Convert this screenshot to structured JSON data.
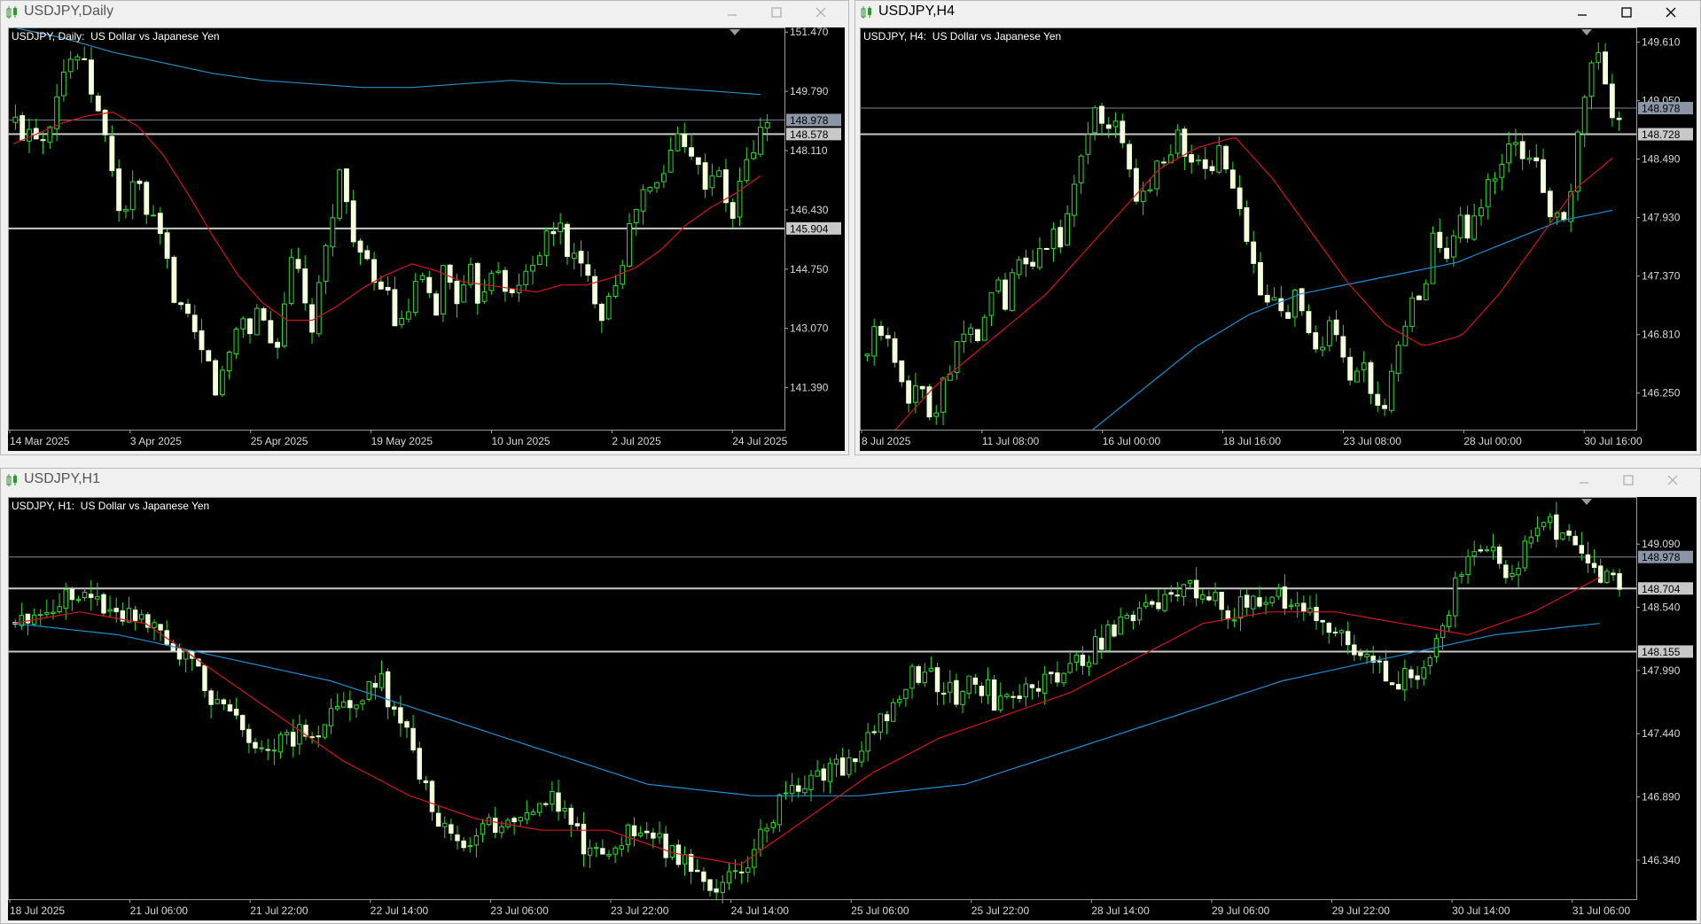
{
  "windows": [
    {
      "id": "daily",
      "title": "USDJPY,Daily",
      "chart_label": "USDJPY, Daily:  US Dollar vs Japanese Yen",
      "active": false,
      "price_ticks": [
        "151.470",
        "149.790",
        "148.110",
        "146.430",
        "144.750",
        "143.070",
        "141.390"
      ],
      "price_tick_values": [
        151.47,
        149.79,
        148.11,
        146.43,
        144.75,
        143.07,
        141.39
      ],
      "time_ticks": [
        "14 Mar 2025",
        "3 Apr 2025",
        "25 Apr 2025",
        "19 May 2025",
        "10 Jun 2025",
        "2 Jul 2025",
        "24 Jul 2025"
      ],
      "price_tags": [
        {
          "label": "148.978",
          "value": 148.978,
          "style": "current"
        },
        {
          "label": "148.578",
          "value": 148.578,
          "style": "level"
        },
        {
          "label": "145.904",
          "value": 145.904,
          "style": "level"
        }
      ],
      "hlines": [
        148.978,
        148.578,
        145.904
      ],
      "ma_colors": {
        "fast": "#d01818",
        "slow": "#2a8fbd"
      }
    },
    {
      "id": "h4",
      "title": "USDJPY,H4",
      "chart_label": "USDJPY, H4:  US Dollar vs Japanese Yen",
      "active": true,
      "price_ticks": [
        "149.610",
        "149.050",
        "148.490",
        "147.930",
        "147.370",
        "146.810",
        "146.250"
      ],
      "price_tick_values": [
        149.61,
        149.05,
        148.49,
        147.93,
        147.37,
        146.81,
        146.25
      ],
      "time_ticks": [
        "8 Jul 2025",
        "11 Jul 08:00",
        "16 Jul 00:00",
        "18 Jul 16:00",
        "23 Jul 08:00",
        "28 Jul 00:00",
        "30 Jul 16:00"
      ],
      "price_tags": [
        {
          "label": "148.978",
          "value": 148.978,
          "style": "current"
        },
        {
          "label": "148.728",
          "value": 148.728,
          "style": "level"
        }
      ],
      "hlines": [
        148.978,
        148.728
      ],
      "ma_colors": {
        "fast": "#d01818",
        "slow": "#1e8fd0"
      }
    },
    {
      "id": "h1",
      "title": "USDJPY,H1",
      "chart_label": "USDJPY, H1:  US Dollar vs Japanese Yen",
      "active": false,
      "price_ticks": [
        "149.090",
        "148.540",
        "147.990",
        "147.440",
        "146.890",
        "146.340"
      ],
      "price_tick_values": [
        149.09,
        148.54,
        147.99,
        147.44,
        146.89,
        146.34
      ],
      "time_ticks": [
        "18 Jul 2025",
        "21 Jul 06:00",
        "21 Jul 22:00",
        "22 Jul 14:00",
        "23 Jul 06:00",
        "23 Jul 22:00",
        "24 Jul 14:00",
        "25 Jul 06:00",
        "25 Jul 22:00",
        "28 Jul 14:00",
        "29 Jul 06:00",
        "29 Jul 22:00",
        "30 Jul 14:00",
        "31 Jul 06:00"
      ],
      "price_tags": [
        {
          "label": "148.978",
          "value": 148.978,
          "style": "current"
        },
        {
          "label": "148.704",
          "value": 148.704,
          "style": "level"
        },
        {
          "label": "148.155",
          "value": 148.155,
          "style": "level"
        }
      ],
      "hlines": [
        148.978,
        148.704,
        148.155
      ],
      "ma_colors": {
        "fast": "#d01818",
        "slow": "#1e8fd0"
      }
    }
  ],
  "chart_data": [
    {
      "type": "candlestick",
      "title": "USDJPY, Daily:  US Dollar vs Japanese Yen",
      "ylim": [
        140.2,
        151.6
      ],
      "close_path": [
        148.9,
        148.6,
        148.9,
        148.4,
        149.1,
        150.2,
        150.6,
        150.9,
        150.3,
        149.6,
        148.6,
        147.8,
        146.1,
        146.8,
        147.2,
        146.3,
        145.9,
        145.2,
        144.2,
        143.6,
        143.0,
        142.4,
        142.1,
        141.3,
        141.9,
        142.9,
        143.4,
        143.0,
        143.9,
        142.6,
        142.8,
        144.2,
        145.2,
        143.6,
        143.1,
        144.4,
        146.1,
        147.5,
        146.5,
        145.5,
        144.9,
        144.1,
        144.6,
        143.6,
        142.9,
        143.6,
        144.4,
        144.1,
        143.5,
        144.8,
        144.3,
        143.8,
        144.6,
        143.9,
        144.6,
        145.1,
        144.4,
        143.8,
        144.5,
        145.0,
        145.3,
        145.6,
        146.1,
        145.4,
        145.0,
        144.6,
        144.2,
        143.6,
        144.1,
        144.8,
        145.6,
        146.5,
        147.0,
        146.9,
        147.4,
        148.1,
        148.7,
        148.4,
        147.6,
        147.2,
        147.7,
        146.8,
        146.2,
        147.3,
        148.0,
        148.5,
        149.0
      ],
      "ma_fast_approx": [
        148.3,
        148.6,
        148.9,
        149.1,
        149.2,
        148.8,
        148.0,
        146.9,
        145.7,
        144.6,
        143.8,
        143.3,
        143.3,
        143.7,
        144.2,
        144.6,
        144.9,
        144.7,
        144.4,
        144.3,
        144.2,
        144.1,
        144.3,
        144.3,
        144.5,
        144.8,
        145.3,
        146.0,
        146.5,
        146.9,
        147.4
      ],
      "ma_slow_approx": [
        151.6,
        151.3,
        150.9,
        150.6,
        150.3,
        150.1,
        150.0,
        149.9,
        149.9,
        150.0,
        150.1,
        150.0,
        150.0,
        149.9,
        149.8,
        149.7
      ]
    },
    {
      "type": "candlestick",
      "title": "USDJPY, H4:  US Dollar vs Japanese Yen",
      "ylim": [
        145.9,
        149.75
      ],
      "close_path": [
        146.6,
        146.9,
        146.7,
        146.5,
        146.2,
        146.3,
        146.0,
        146.4,
        146.6,
        146.9,
        146.7,
        147.0,
        147.3,
        147.1,
        147.5,
        147.4,
        147.6,
        147.8,
        147.7,
        148.1,
        148.6,
        149.0,
        148.8,
        148.9,
        148.6,
        148.0,
        148.2,
        148.5,
        148.6,
        148.7,
        148.5,
        148.4,
        148.3,
        148.6,
        148.2,
        147.8,
        147.4,
        147.1,
        147.3,
        147.0,
        147.2,
        146.8,
        146.5,
        146.9,
        146.6,
        146.3,
        146.5,
        146.2,
        146.0,
        146.5,
        146.9,
        147.1,
        147.4,
        147.8,
        147.6,
        147.9,
        147.7,
        148.0,
        148.3,
        148.5,
        148.7,
        148.4,
        148.6,
        148.2,
        147.9,
        147.8,
        148.6,
        149.2,
        149.5,
        149.0,
        148.9
      ],
      "ma_fast_approx": [
        145.9,
        146.3,
        146.6,
        146.9,
        147.2,
        147.6,
        148.0,
        148.4,
        148.6,
        148.7,
        148.3,
        147.8,
        147.3,
        146.9,
        146.7,
        146.8,
        147.2,
        147.7,
        148.2,
        148.5
      ],
      "ma_slow_approx": [
        145.9,
        146.3,
        146.7,
        147.0,
        147.2,
        147.3,
        147.4,
        147.5,
        147.7,
        147.9,
        148.0
      ]
    },
    {
      "type": "candlestick",
      "title": "USDJPY, H1:  US Dollar vs Japanese Yen",
      "ylim": [
        146.0,
        149.5
      ],
      "close_path": [
        148.4,
        148.5,
        148.6,
        148.7,
        148.6,
        148.5,
        148.5,
        148.3,
        148.1,
        147.8,
        147.6,
        147.4,
        147.3,
        147.4,
        147.5,
        147.6,
        147.8,
        147.9,
        147.6,
        147.0,
        146.6,
        146.5,
        146.6,
        146.7,
        146.8,
        146.9,
        146.6,
        146.4,
        146.5,
        146.6,
        146.5,
        146.4,
        146.2,
        146.1,
        146.3,
        146.6,
        146.9,
        147.0,
        147.1,
        147.2,
        147.4,
        147.7,
        148.0,
        147.9,
        147.8,
        147.9,
        147.7,
        147.8,
        147.9,
        148.0,
        148.1,
        148.3,
        148.5,
        148.6,
        148.6,
        148.7,
        148.6,
        148.5,
        148.6,
        148.7,
        148.5,
        148.4,
        148.3,
        148.1,
        148.0,
        147.9,
        148.1,
        148.5,
        149.1,
        149.0,
        148.8,
        149.3,
        149.2,
        149.0,
        148.8,
        148.8
      ],
      "ma_fast_approx": [
        148.4,
        148.5,
        148.4,
        148.0,
        147.6,
        147.2,
        146.9,
        146.7,
        146.6,
        146.6,
        146.4,
        146.3,
        146.7,
        147.1,
        147.4,
        147.6,
        147.8,
        148.1,
        148.4,
        148.5,
        148.5,
        148.4,
        148.3,
        148.5,
        148.8
      ],
      "ma_slow_approx": [
        148.4,
        148.3,
        148.1,
        147.9,
        147.6,
        147.3,
        147.0,
        146.9,
        146.9,
        147.0,
        147.3,
        147.6,
        147.9,
        148.1,
        148.3,
        148.4
      ]
    }
  ]
}
